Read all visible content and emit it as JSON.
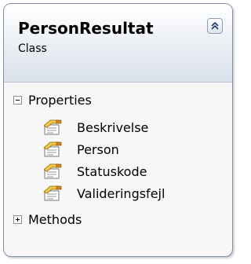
{
  "class": {
    "name": "PersonResultat",
    "kind": "Class"
  },
  "sections": {
    "properties": {
      "label": "Properties",
      "expanded": true,
      "items": [
        "Beskrivelse",
        "Person",
        "Statuskode",
        "Valideringsfejl"
      ]
    },
    "methods": {
      "label": "Methods",
      "expanded": false
    }
  },
  "icons": {
    "collapse": "double-chevron-up-icon",
    "property": "property-icon"
  }
}
